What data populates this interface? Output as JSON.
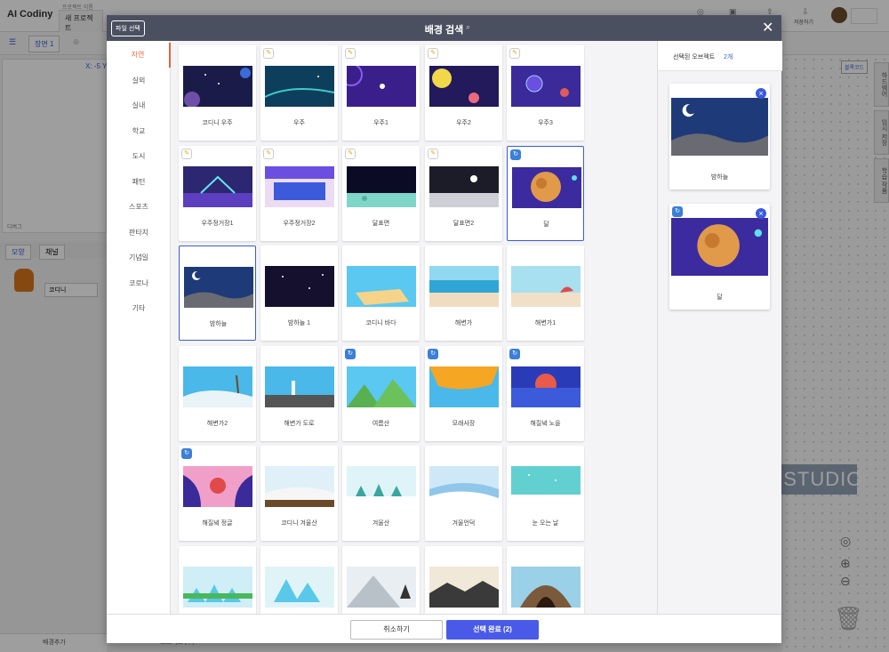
{
  "app": {
    "logo": "AI Codiny",
    "project_label": "프로젝트 이름",
    "project_name": "새 프로젝트",
    "scene_tab": "장면 1",
    "coord": "X: -5 Y",
    "debug": "디버그",
    "tab_shape": "모양",
    "tab_sound": "채널",
    "object_name": "코디니",
    "save_label": "저장하기",
    "block_code": "블록코드",
    "side_tabs": [
      "하드웨어",
      "임시 저장",
      "학습 작품"
    ],
    "bottom_bg": "배경추가",
    "bottom_obj": "오브젝트추가",
    "watermark": "JUUNNYSTUDIO"
  },
  "modal": {
    "file_button": "파일 선택",
    "title": "배경 검색",
    "categories": [
      "자연",
      "실외",
      "실내",
      "학교",
      "도시",
      "패턴",
      "스포츠",
      "판타지",
      "기념일",
      "코로나",
      "기타"
    ],
    "active_category": "자연",
    "items": [
      {
        "label": "코디니 우주",
        "badge": "",
        "scene": "space1",
        "selected": false
      },
      {
        "label": "우주",
        "badge": "edit",
        "scene": "space2",
        "selected": false
      },
      {
        "label": "우주1",
        "badge": "edit",
        "scene": "space3",
        "selected": false
      },
      {
        "label": "우주2",
        "badge": "edit",
        "scene": "space4",
        "selected": false
      },
      {
        "label": "우주3",
        "badge": "edit",
        "scene": "space5",
        "selected": false
      },
      {
        "label": "우주정거장1",
        "badge": "edit",
        "scene": "station1",
        "selected": false
      },
      {
        "label": "우주정거장2",
        "badge": "edit",
        "scene": "station2",
        "selected": false
      },
      {
        "label": "달표면",
        "badge": "edit",
        "scene": "moon1",
        "selected": false
      },
      {
        "label": "달표면2",
        "badge": "edit",
        "scene": "moon2",
        "selected": false
      },
      {
        "label": "달",
        "badge": "ai",
        "scene": "planet",
        "selected": true
      },
      {
        "label": "밤하늘",
        "badge": "",
        "scene": "night",
        "selected": true
      },
      {
        "label": "밤하늘 1",
        "badge": "",
        "scene": "night2",
        "selected": false
      },
      {
        "label": "코디니 바다",
        "badge": "",
        "scene": "beach1",
        "selected": false
      },
      {
        "label": "해변가",
        "badge": "",
        "scene": "beach2",
        "selected": false
      },
      {
        "label": "해변가1",
        "badge": "",
        "scene": "beach3",
        "selected": false
      },
      {
        "label": "해변가2",
        "badge": "",
        "scene": "beach4",
        "selected": false
      },
      {
        "label": "해변가 도로",
        "badge": "",
        "scene": "beach5",
        "selected": false
      },
      {
        "label": "여름산",
        "badge": "ai",
        "scene": "mount1",
        "selected": false
      },
      {
        "label": "모래사장",
        "badge": "ai",
        "scene": "sand",
        "selected": false
      },
      {
        "label": "해질녘 노을",
        "badge": "ai",
        "scene": "sunset",
        "selected": false
      },
      {
        "label": "해질녘 정글",
        "badge": "ai",
        "scene": "jungle",
        "selected": false
      },
      {
        "label": "코디니 겨울산",
        "badge": "",
        "scene": "winter1",
        "selected": false
      },
      {
        "label": "겨울산",
        "badge": "",
        "scene": "winter2",
        "selected": false
      },
      {
        "label": "겨울언덕",
        "badge": "",
        "scene": "winter3",
        "selected": false
      },
      {
        "label": "눈 오는 날",
        "badge": "",
        "scene": "snow",
        "selected": false
      },
      {
        "label": "",
        "badge": "",
        "scene": "ice1",
        "selected": false
      },
      {
        "label": "",
        "badge": "",
        "scene": "ice2",
        "selected": false
      },
      {
        "label": "",
        "badge": "",
        "scene": "snowmount",
        "selected": false
      },
      {
        "label": "",
        "badge": "",
        "scene": "rocks",
        "selected": false
      },
      {
        "label": "",
        "badge": "",
        "scene": "cave",
        "selected": false
      }
    ],
    "selected_panel": {
      "title": "선택된 오브젝트",
      "count": "2개",
      "items": [
        {
          "label": "밤하늘",
          "scene": "night"
        },
        {
          "label": "달",
          "scene": "planet"
        }
      ]
    },
    "cancel_button": "취소하기",
    "confirm_button": "선택 완료 (2)"
  }
}
